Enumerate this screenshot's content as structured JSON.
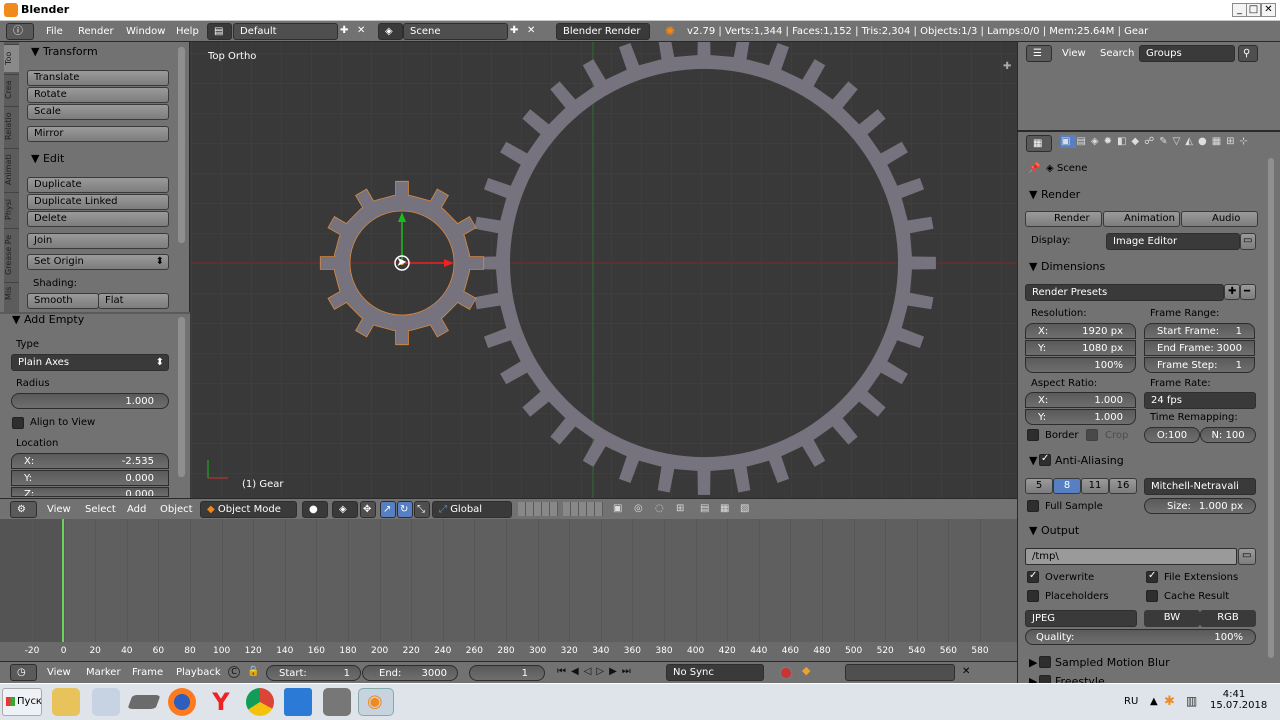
{
  "window": {
    "title": "Blender",
    "btn_min": "_",
    "btn_max": "□",
    "btn_close": "✕"
  },
  "topbar": {
    "menus": [
      "File",
      "Render",
      "Window",
      "Help"
    ],
    "layout": "Default",
    "scene": "Scene",
    "engine": "Blender Render",
    "stats": "v2.79 | Verts:1,344 | Faces:1,152 | Tris:2,304 | Objects:1/3 | Lamps:0/0 | Mem:25.64M | Gear"
  },
  "tabs": [
    "Too",
    "Crea",
    "Relatio",
    "Animati",
    "Physi",
    "Grease Pe",
    "Mis"
  ],
  "shelf": {
    "transform": {
      "title": "Transform",
      "items": [
        "Translate",
        "Rotate",
        "Scale",
        "Mirror"
      ]
    },
    "edit": {
      "title": "Edit",
      "items": [
        "Duplicate",
        "Duplicate Linked",
        "Delete",
        "Join"
      ],
      "set_origin": "Set Origin",
      "shading_label": "Shading:",
      "smooth": "Smooth",
      "flat": "Flat"
    },
    "add_empty": {
      "title": "Add Empty",
      "type_label": "Type",
      "type_value": "Plain Axes",
      "radius_label": "Radius",
      "radius_value": "1.000",
      "align_label": "Align to View",
      "location_label": "Location",
      "x_label": "X:",
      "x_value": "-2.535",
      "y_label": "Y:",
      "y_value": "0.000",
      "z_label": "Z:",
      "z_value": "0.000"
    }
  },
  "viewport": {
    "view_label": "Top Ortho",
    "object_label": "(1) Gear",
    "small_gear_teeth": 12,
    "big_gear_teeth": 36
  },
  "vpheader": {
    "menus": [
      "View",
      "Select",
      "Add",
      "Object"
    ],
    "mode": "Object Mode",
    "orientation": "Global"
  },
  "timeline": {
    "ticks": [
      "-20",
      "0",
      "20",
      "40",
      "60",
      "80",
      "100",
      "120",
      "140",
      "160",
      "180",
      "200",
      "220",
      "240",
      "260",
      "280",
      "300",
      "320",
      "340",
      "360",
      "380",
      "400",
      "420",
      "440",
      "460",
      "480",
      "500",
      "520",
      "540",
      "560",
      "580"
    ]
  },
  "tlheader": {
    "menus": [
      "View",
      "Marker",
      "Frame",
      "Playback"
    ],
    "start_label": "Start:",
    "start_value": "1",
    "end_label": "End:",
    "end_value": "3000",
    "current": "1",
    "sync": "No Sync"
  },
  "outliner": {
    "view": "View",
    "search": "Search",
    "groups": "Groups"
  },
  "props": {
    "scene": "Scene",
    "render": {
      "title": "Render",
      "render_btn": "Render",
      "anim_btn": "Animation",
      "audio_btn": "Audio",
      "display_label": "Display:",
      "display_value": "Image Editor"
    },
    "dimensions": {
      "title": "Dimensions",
      "presets": "Render Presets",
      "resolution_label": "Resolution:",
      "x_label": "X:",
      "x_value": "1920 px",
      "y_label": "Y:",
      "y_value": "1080 px",
      "percent": "100%",
      "frame_range_label": "Frame Range:",
      "start_label": "Start Frame:",
      "start_value": "1",
      "end_label": "End Frame:",
      "end_value": "3000",
      "step_label": "Frame Step:",
      "step_value": "1",
      "aspect_label": "Aspect Ratio:",
      "ax_label": "X:",
      "ax_value": "1.000",
      "ay_label": "Y:",
      "ay_value": "1.000",
      "frame_rate_label": "Frame Rate:",
      "fps": "24 fps",
      "remap_label": "Time Remapping:",
      "remap_old": "O:100",
      "remap_new": "N: 100",
      "border_label": "Border",
      "crop_label": "Crop"
    },
    "aa": {
      "title": "Anti-Aliasing",
      "samples": [
        "5",
        "8",
        "11",
        "16"
      ],
      "filter": "Mitchell-Netravali",
      "full_sample": "Full Sample",
      "size_label": "Size:",
      "size_value": "1.000 px"
    },
    "output": {
      "title": "Output",
      "path": "/tmp\\",
      "overwrite": "Overwrite",
      "file_ext": "File Extensions",
      "placeholders": "Placeholders",
      "cache": "Cache Result",
      "format": "JPEG",
      "bw": "BW",
      "rgb": "RGB",
      "quality_label": "Quality:",
      "quality_value": "100%"
    },
    "motion_blur": "Sampled Motion Blur",
    "freestyle": "Freestyle"
  },
  "taskbar": {
    "start": "Пуск",
    "lang": "RU",
    "time": "4:41",
    "date": "15.07.2018"
  }
}
